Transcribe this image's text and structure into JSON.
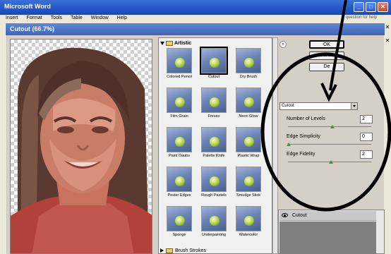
{
  "word": {
    "title": "Microsoft Word",
    "menu": [
      "Insert",
      "Format",
      "Tools",
      "Table",
      "Window",
      "Help"
    ],
    "help_placeholder": "question for help",
    "buttons": {
      "minimize": "_",
      "maximize": "□",
      "close": "✕"
    }
  },
  "dialog": {
    "title": "Cutout (66.7%)"
  },
  "gallery": {
    "category": "Artistic",
    "filters": [
      "Colored Pencil",
      "Cutout",
      "Dry Brush",
      "Film Grain",
      "Fresco",
      "Neon Glow",
      "Paint Daubs",
      "Palette Knife",
      "Plastic Wrap",
      "Poster Edges",
      "Rough Pastels",
      "Smudge Stick",
      "Sponge",
      "Underpainting",
      "Watercolor"
    ],
    "selected": "Cutout",
    "next_category": "Brush Strokes"
  },
  "panel": {
    "ok_label": "OK",
    "cancel_label": "Cance",
    "default_label": "De",
    "filter_select": "Cutout",
    "params": [
      {
        "name": "Number of Levels",
        "value": "2"
      },
      {
        "name": "Edge Simplicity",
        "value": "0"
      },
      {
        "name": "Edge Fidelity",
        "value": "2"
      }
    ],
    "layer": "Cutout"
  },
  "colors": {
    "annotation": "#000000",
    "title_blue": "#3a6fd8",
    "dialog_blue": "#5f86d8"
  }
}
